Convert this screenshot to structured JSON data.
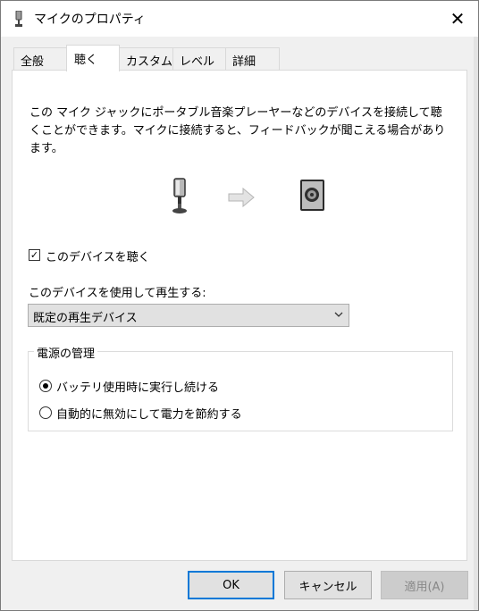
{
  "window": {
    "title": "マイクのプロパティ",
    "close_glyph": "✕"
  },
  "tabs": [
    {
      "label": "全般"
    },
    {
      "label": "聴く"
    },
    {
      "label": "カスタム"
    },
    {
      "label": "レベル"
    },
    {
      "label": "詳細"
    }
  ],
  "active_tab": "聴く",
  "description": "この マイク ジャックにポータブル音楽プレーヤーなどのデバイスを接続して聴くことができます。マイクに接続すると、フィードバックが聞こえる場合があります。",
  "listen": {
    "checked": true,
    "label": "このデバイスを聴く"
  },
  "playback": {
    "label": "このデバイスを使用して再生する:",
    "selected": "既定の再生デバイス"
  },
  "power": {
    "legend": "電源の管理",
    "options": [
      {
        "label": "バッテリ使用時に実行し続ける",
        "selected": true
      },
      {
        "label": "自動的に無効にして電力を節約する",
        "selected": false
      }
    ]
  },
  "buttons": {
    "ok": "OK",
    "cancel": "キャンセル",
    "apply": "適用(A)",
    "apply_enabled": false
  },
  "icons": {
    "title": "microphone-icon",
    "source": "microphone-icon",
    "flow": "arrow-right-icon",
    "target": "speaker-icon",
    "dropdown": "chevron-down-icon"
  },
  "colors": {
    "focus_border": "#0078d7",
    "panel_bg": "#ffffff",
    "window_bg": "#f0f0f0"
  }
}
